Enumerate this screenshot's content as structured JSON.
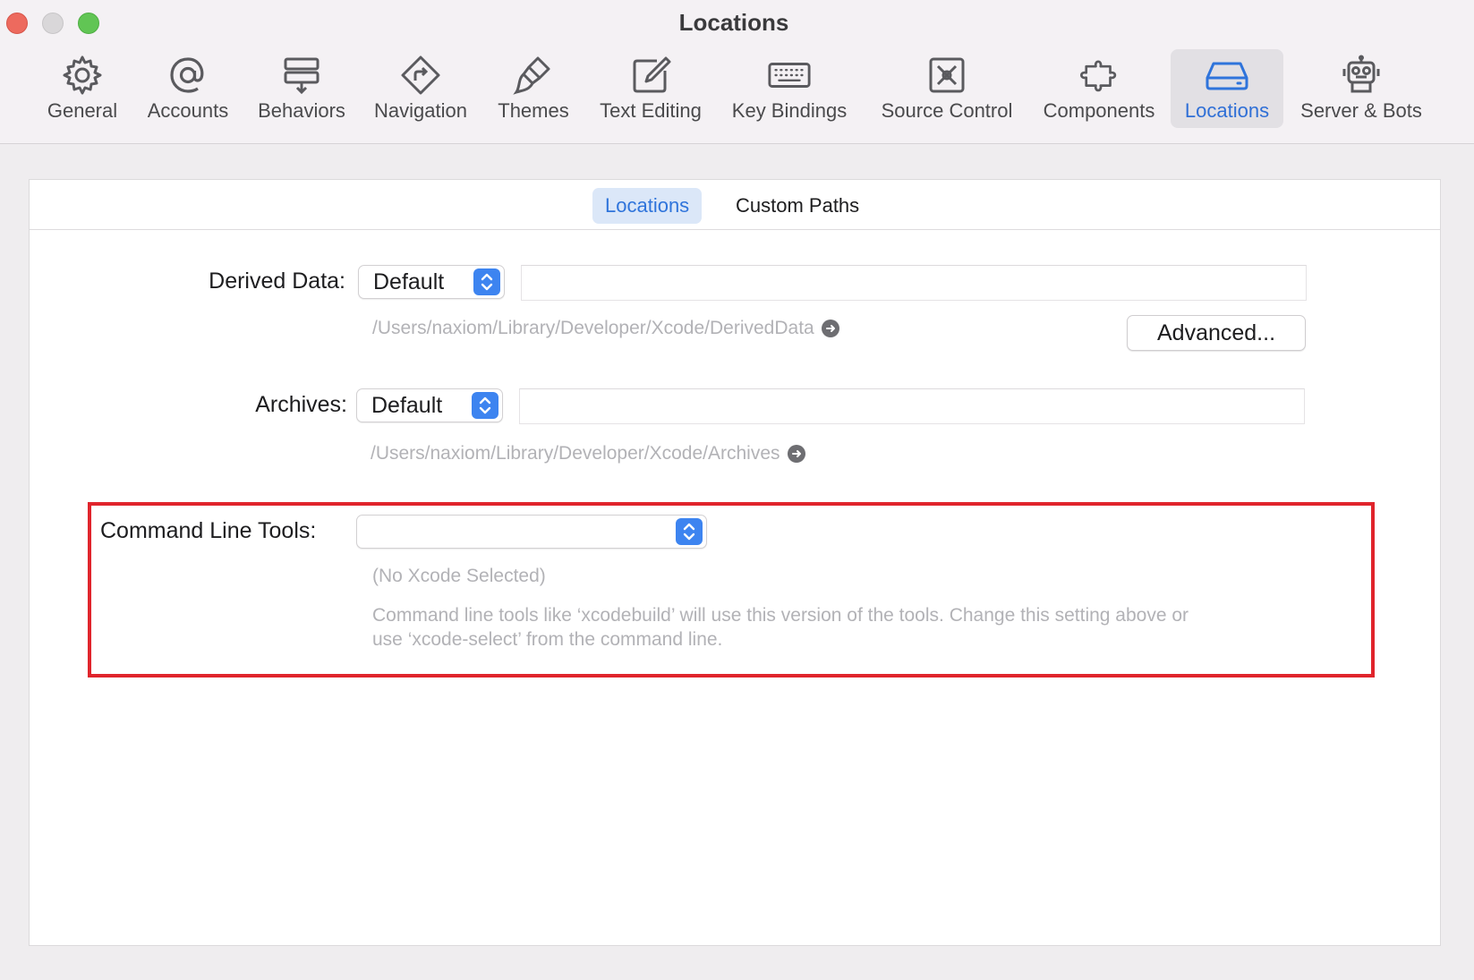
{
  "window": {
    "title": "Locations"
  },
  "toolbar": {
    "items": [
      {
        "label": "General",
        "icon": "gear-icon",
        "selected": false
      },
      {
        "label": "Accounts",
        "icon": "at-sign-icon",
        "selected": false
      },
      {
        "label": "Behaviors",
        "icon": "behaviors-icon",
        "selected": false
      },
      {
        "label": "Navigation",
        "icon": "navigation-diamond-icon",
        "selected": false
      },
      {
        "label": "Themes",
        "icon": "paintbrush-icon",
        "selected": false
      },
      {
        "label": "Text Editing",
        "icon": "pencil-square-icon",
        "selected": false
      },
      {
        "label": "Key Bindings",
        "icon": "keyboard-icon",
        "selected": false
      },
      {
        "label": "Source Control",
        "icon": "source-control-icon",
        "selected": false
      },
      {
        "label": "Components",
        "icon": "puzzle-piece-icon",
        "selected": false
      },
      {
        "label": "Locations",
        "icon": "drive-icon",
        "selected": true
      },
      {
        "label": "Server & Bots",
        "icon": "robot-icon",
        "selected": false
      }
    ]
  },
  "tabs": {
    "locations": "Locations",
    "custom_paths": "Custom Paths"
  },
  "derived_data": {
    "label": "Derived Data:",
    "value": "Default",
    "path": "/Users/naxiom/Library/Developer/Xcode/DerivedData",
    "advanced_button": "Advanced..."
  },
  "archives": {
    "label": "Archives:",
    "value": "Default",
    "path": "/Users/naxiom/Library/Developer/Xcode/Archives"
  },
  "command_line_tools": {
    "label": "Command Line Tools:",
    "value": "",
    "status": "(No Xcode Selected)",
    "help_line1": "Command line tools like ‘xcodebuild’ will use this version of the tools. Change this setting above or",
    "help_line2": "use ‘xcode-select’ from the command line."
  },
  "colors": {
    "accent": "#2f74db",
    "highlight": "#e0242c"
  }
}
